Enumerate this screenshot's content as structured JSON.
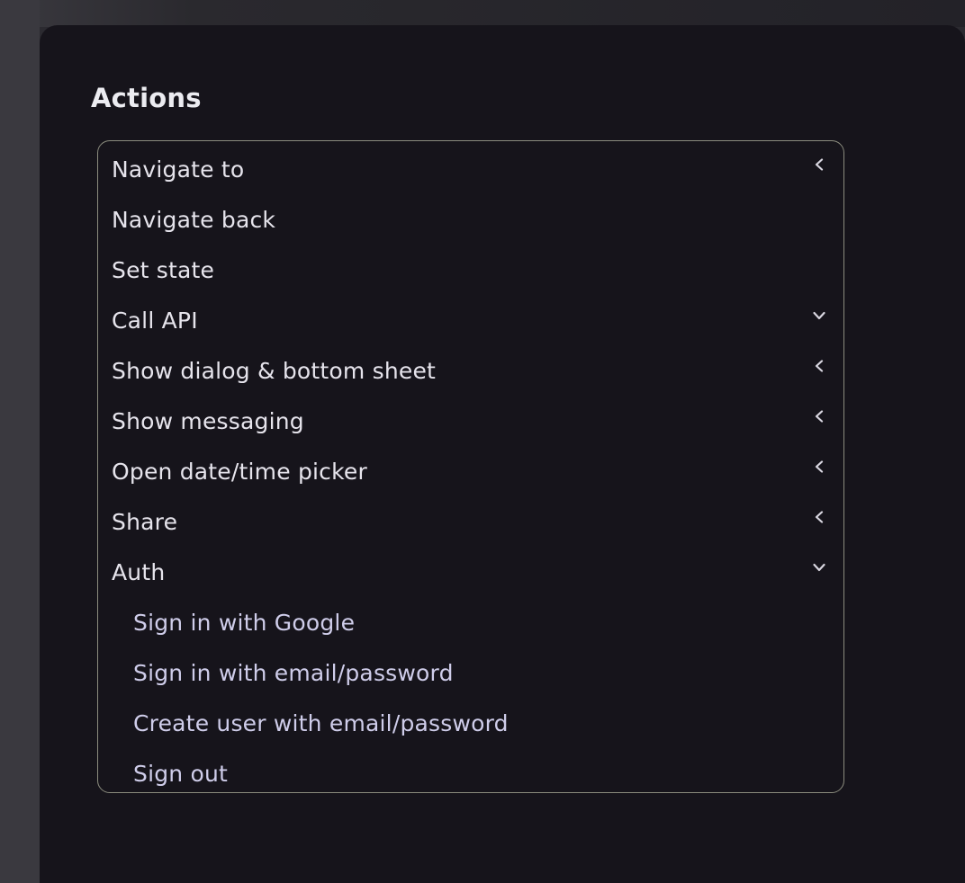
{
  "panel": {
    "title": "Actions"
  },
  "menu": {
    "items": [
      {
        "label": "Navigate to",
        "icon": "chevron-left-icon",
        "indent": false
      },
      {
        "label": "Navigate back",
        "icon": null,
        "indent": false
      },
      {
        "label": "Set state",
        "icon": null,
        "indent": false
      },
      {
        "label": "Call API",
        "icon": "chevron-down-icon",
        "indent": false
      },
      {
        "label": "Show dialog & bottom sheet",
        "icon": "chevron-left-icon",
        "indent": false
      },
      {
        "label": "Show messaging",
        "icon": "chevron-left-icon",
        "indent": false
      },
      {
        "label": "Open date/time picker",
        "icon": "chevron-left-icon",
        "indent": false
      },
      {
        "label": "Share",
        "icon": "chevron-left-icon",
        "indent": false
      },
      {
        "label": "Auth",
        "icon": "chevron-down-icon",
        "indent": false
      },
      {
        "label": "Sign in with Google",
        "icon": null,
        "indent": true
      },
      {
        "label": "Sign in with email/password",
        "icon": null,
        "indent": true
      },
      {
        "label": "Create user with email/password",
        "icon": null,
        "indent": true
      },
      {
        "label": "Sign out",
        "icon": null,
        "indent": true
      }
    ]
  },
  "colors": {
    "panel_bg": "#16141b",
    "text": "#e6e4ec",
    "sub_text": "#cfcdea",
    "border": "#8b8c7e"
  }
}
